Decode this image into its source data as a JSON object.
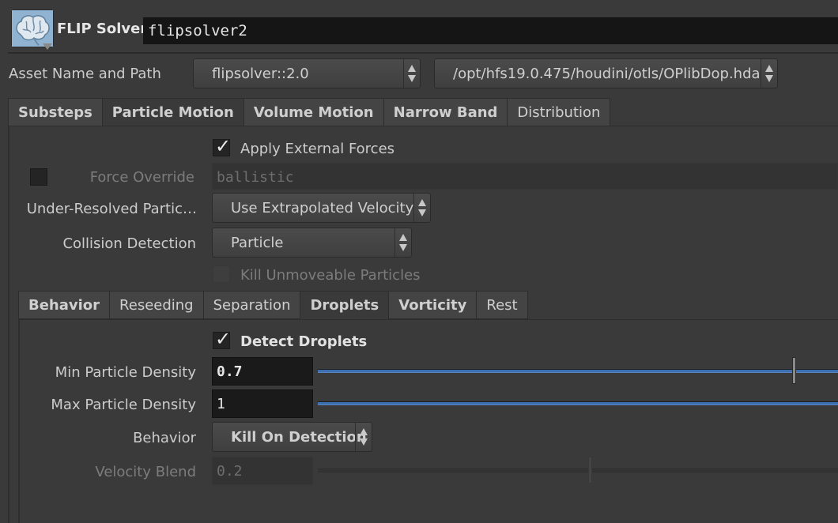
{
  "header": {
    "icon": "brain-icon",
    "node_type": "FLIP Solver",
    "node_name": "flipsolver2"
  },
  "asset": {
    "label": "Asset Name and Path",
    "name_value": "flipsolver::2.0",
    "path_value": "/opt/hfs19.0.475/houdini/otls/OPlibDop.hda"
  },
  "main_tabs": [
    "Substeps",
    "Particle Motion",
    "Volume Motion",
    "Narrow Band",
    "Distribution"
  ],
  "particle_motion": {
    "apply_external_forces": "Apply External Forces",
    "force_override_label": "Force Override",
    "force_override_value": "ballistic",
    "under_resolved_label": "Under-Resolved Partic…",
    "under_resolved_value": "Use Extrapolated Velocity",
    "collision_label": "Collision Detection",
    "collision_value": "Particle",
    "kill_unmoveable": "Kill Unmoveable Particles"
  },
  "sub_tabs": [
    "Behavior",
    "Reseeding",
    "Separation",
    "Droplets",
    "Vorticity",
    "Rest"
  ],
  "droplets": {
    "detect_label": "Detect Droplets",
    "min_label": "Min Particle Density",
    "min_value": "0.7",
    "max_label": "Max Particle Density",
    "max_value": "1",
    "behavior_label": "Behavior",
    "behavior_value": "Kill On Detection",
    "velocity_label": "Velocity Blend",
    "velocity_value": "0.2"
  }
}
